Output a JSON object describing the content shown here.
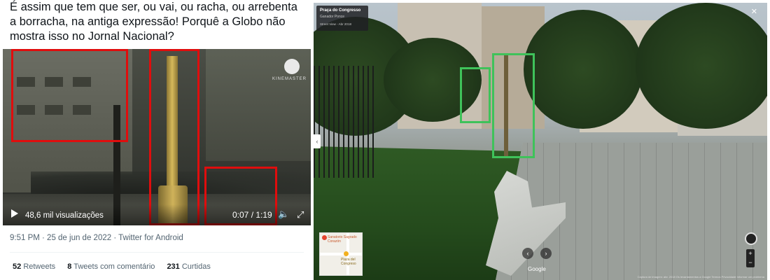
{
  "tweet": {
    "text": "É assim que tem que ser, ou vai, ou racha, ou arrebenta a borracha, na antiga expressão! Porquê a Globo não mostra isso no Jornal Nacional?",
    "video": {
      "watermark": "KINEMASTER",
      "views": "48,6 mil visualizações",
      "time": "0:07 / 1:19"
    },
    "meta": "9:51 PM · 25 de jun de 2022 · Twitter for Android",
    "stats": {
      "retweets_count": "52",
      "retweets_label": "Retweets",
      "comments_count": "8",
      "comments_label": "Tweets com comentário",
      "likes_count": "231",
      "likes_label": "Curtidas"
    },
    "highlight_color": "#e00d0d"
  },
  "streetview": {
    "place_title": "Praça do Congresso",
    "place_sub": "Ganador Ponce",
    "date": "Street View - Abr 2018",
    "minimap": {
      "label_main": "Sanatorio Sagrado Corazón",
      "label_secondary": "Plaza del Congreso"
    },
    "google_label": "Google",
    "footer": "Captura de imagem: abr. 2018   Os levantamentos a Google   Termos   Privacidade   Informar um problema",
    "highlight_color": "#3fc25a"
  }
}
